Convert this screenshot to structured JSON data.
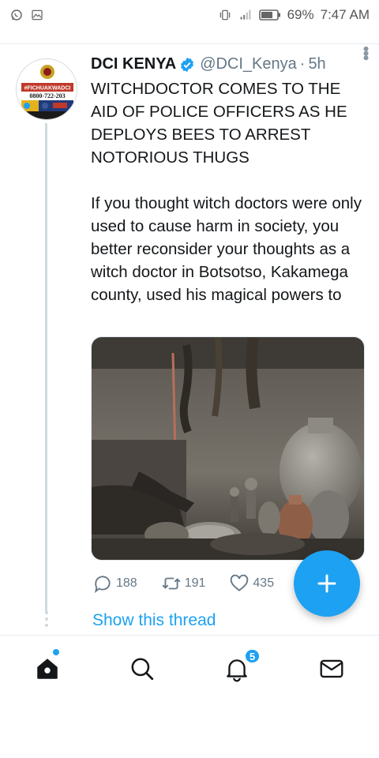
{
  "status_bar": {
    "left_icons": [
      "whatsapp-icon",
      "image-icon"
    ],
    "right_icons": [
      "vibrate-icon",
      "signal-icon",
      "battery-icon"
    ],
    "battery": "69%",
    "time": "7:47 AM"
  },
  "tweet": {
    "author_name": "DCI KENYA",
    "handle": "@DCI_Kenya",
    "separator": "·",
    "age": "5h",
    "verified": true,
    "avatar_text": "#FICHUAKWADCI",
    "avatar_phone": "0800-722-203",
    "paragraphs": [
      "WITCHDOCTOR COMES TO THE AID OF POLICE OFFICERS AS HE DEPLOYS BEES TO ARREST NOTORIOUS THUGS",
      "If you thought witch doctors were only used to cause harm in society, you better reconsider your thoughts as a witch doctor in Botsotso, Kakamega county, used his magical powers to"
    ],
    "replies": "188",
    "retweets": "191",
    "likes": "435",
    "show_thread": "Show this thread"
  },
  "nav": {
    "items": [
      "home-icon",
      "search-icon",
      "notifications-icon",
      "messages-icon"
    ],
    "notification_count": "5"
  },
  "colors": {
    "accent": "#1da1f2",
    "text": "#14171a",
    "muted": "#657786"
  }
}
